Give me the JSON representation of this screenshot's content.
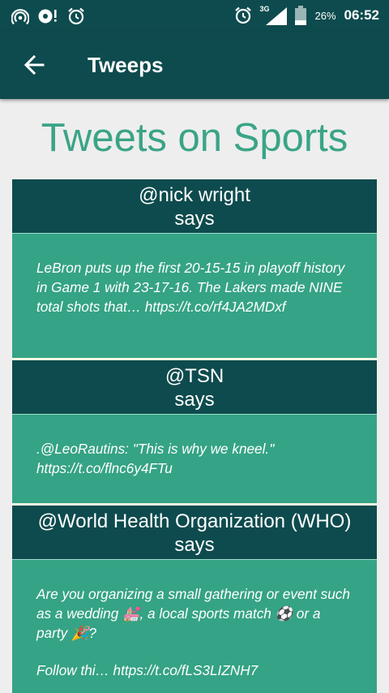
{
  "status": {
    "network": "3G",
    "battery": "26%",
    "time": "06:52"
  },
  "appbar": {
    "title": "Tweeps"
  },
  "heading": "Tweets on Sports",
  "says_label": "says",
  "tweets": [
    {
      "handle": "@nick wright",
      "text": "LeBron puts up the first 20-15-15 in playoff history in Game 1 with 23-17-16. The Lakers made NINE total shots that… https://t.co/rf4JA2MDxf"
    },
    {
      "handle": "@TSN",
      "text": ".@LeoRautins: \"This is why we kneel.\" https://t.co/flnc6y4FTu"
    },
    {
      "handle": "@World Health Organization (WHO)",
      "text_line1": "Are you organizing a small gathering or event such as a wedding 💒, a local sports match ⚽ or a party 🎉?",
      "text_line2": "Follow thi… https://t.co/fLS3LIZNH7"
    }
  ]
}
